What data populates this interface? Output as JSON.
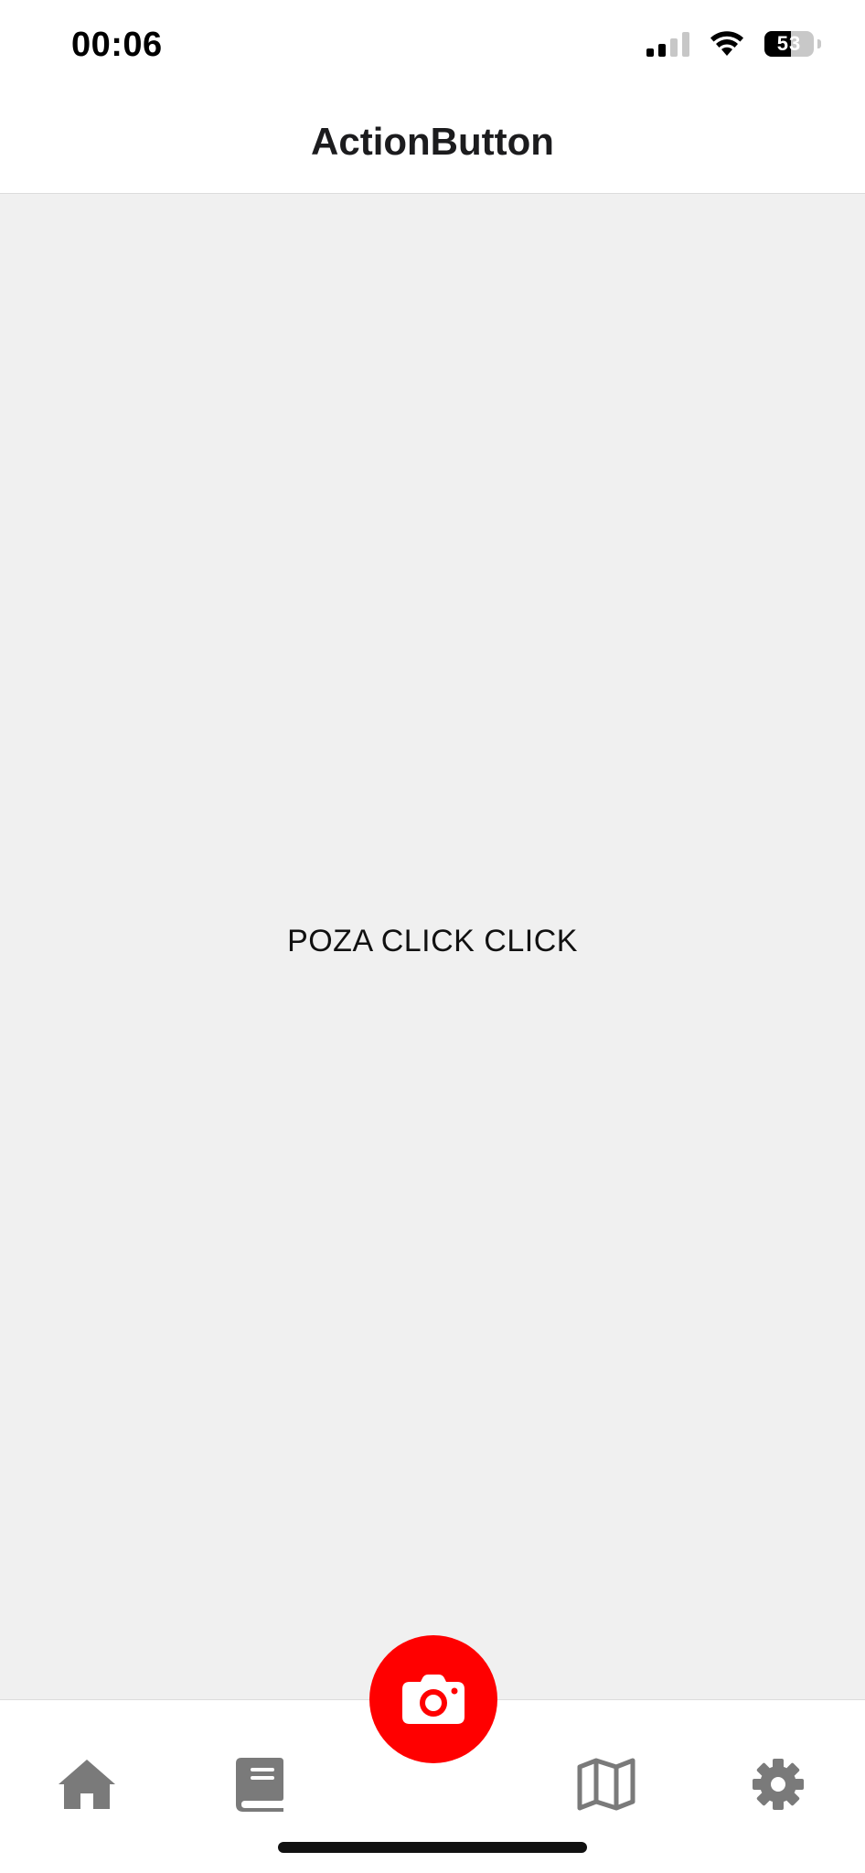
{
  "status_bar": {
    "time": "00:06",
    "battery_percent": "53",
    "signal_bars_active": 2,
    "signal_bars_total": 4
  },
  "header": {
    "title": "ActionButton"
  },
  "main": {
    "text": "POZA CLICK CLICK",
    "background_color": "#f0f0f0"
  },
  "tab_bar": {
    "tabs": [
      {
        "icon": "home-icon"
      },
      {
        "icon": "book-icon"
      },
      {
        "icon": "map-icon"
      },
      {
        "icon": "gear-icon"
      }
    ],
    "icon_color": "#7a7a7a",
    "action_button": {
      "icon": "camera-icon",
      "color": "#ff0000"
    }
  }
}
